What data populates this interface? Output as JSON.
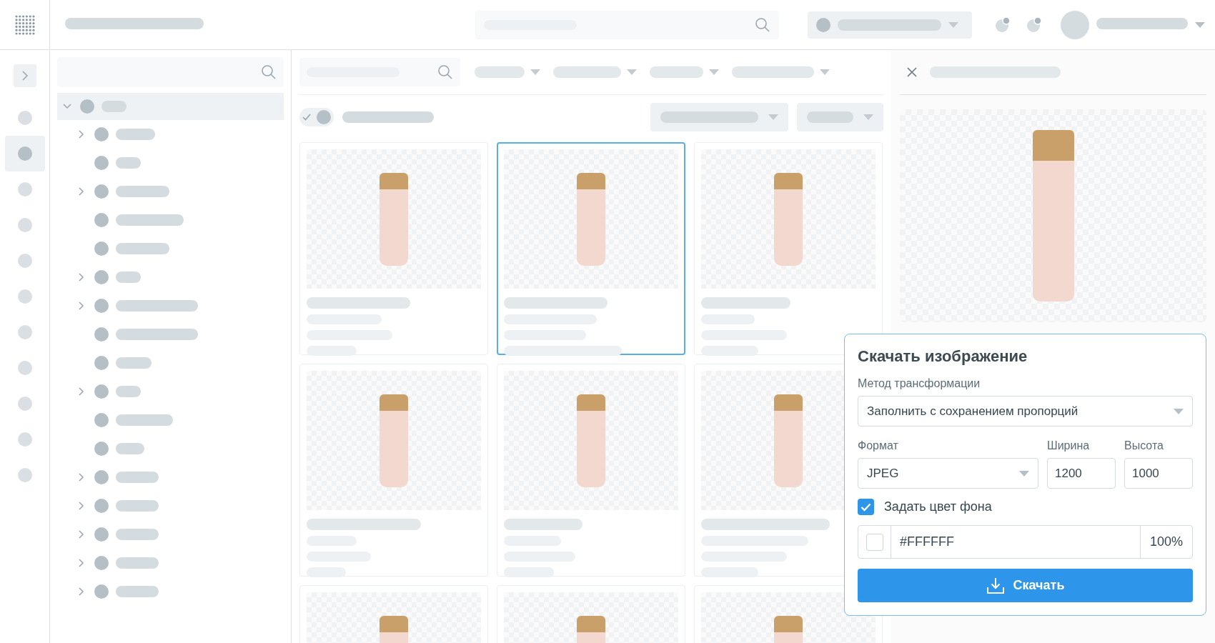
{
  "rail": {
    "items": [
      {
        "selected": false
      },
      {
        "selected": true
      },
      {
        "selected": false
      },
      {
        "selected": false
      },
      {
        "selected": false
      },
      {
        "selected": false
      },
      {
        "selected": false
      },
      {
        "selected": false
      },
      {
        "selected": false
      },
      {
        "selected": false
      },
      {
        "selected": false
      }
    ]
  },
  "tree": {
    "root": {
      "selected": true,
      "expanded": true,
      "children": [
        {
          "kind": "branch",
          "expanded": false,
          "selected": false
        },
        {
          "kind": "leaf",
          "selected": false
        },
        {
          "kind": "branch",
          "expanded": false,
          "selected": false
        },
        {
          "kind": "leaf",
          "selected": false
        },
        {
          "kind": "leaf",
          "selected": false
        },
        {
          "kind": "branch",
          "expanded": false,
          "selected": false
        },
        {
          "kind": "branch",
          "expanded": false,
          "selected": false
        },
        {
          "kind": "leaf",
          "selected": false
        },
        {
          "kind": "leaf",
          "selected": false
        },
        {
          "kind": "branch",
          "expanded": false,
          "selected": false
        },
        {
          "kind": "leaf",
          "selected": false
        },
        {
          "kind": "leaf",
          "selected": false
        },
        {
          "kind": "branch",
          "expanded": false,
          "selected": false
        },
        {
          "kind": "branch",
          "expanded": false,
          "selected": false
        },
        {
          "kind": "branch",
          "expanded": false,
          "selected": false
        },
        {
          "kind": "branch",
          "expanded": false,
          "selected": false
        },
        {
          "kind": "branch",
          "expanded": false,
          "selected": false
        }
      ]
    }
  },
  "grid": {
    "toggle": {
      "on": true
    },
    "cards": [
      {
        "selected": false
      },
      {
        "selected": true
      },
      {
        "selected": false
      },
      {
        "selected": false
      },
      {
        "selected": false
      },
      {
        "selected": false
      },
      {
        "selected": false
      },
      {
        "selected": false
      },
      {
        "selected": false
      }
    ]
  },
  "download_dialog": {
    "title": "Скачать изображение",
    "method_label": "Метод трансформации",
    "method_value": "Заполнить с сохранением пропорций",
    "format_label": "Формат",
    "format_value": "JPEG",
    "width_label": "Ширина",
    "width_value": "1200",
    "height_label": "Высота",
    "height_value": "1000",
    "background_checkbox": {
      "label": "Задать цвет фона",
      "checked": true
    },
    "color_value": "#FFFFFF",
    "opacity_value": "100%",
    "download_button": "Скачать"
  }
}
